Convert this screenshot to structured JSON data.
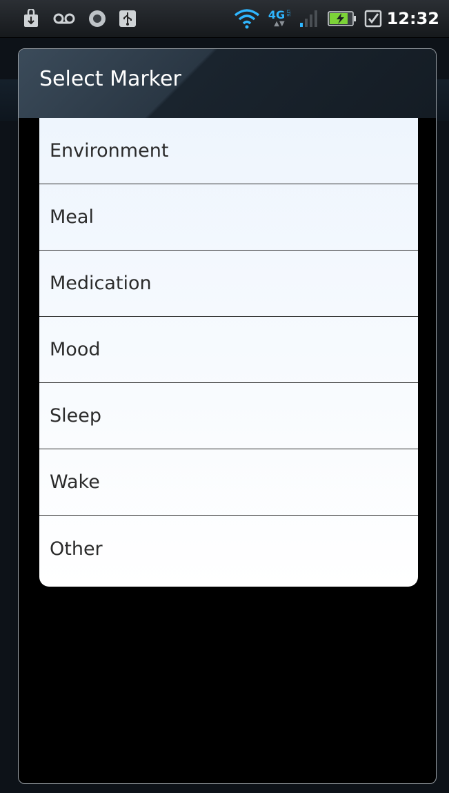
{
  "status_bar": {
    "time": "12:32",
    "network_label": "4G",
    "network_sub_label": "LTE",
    "icons": [
      "download-icon",
      "voicemail-icon",
      "app-icon",
      "usb-icon",
      "wifi-icon",
      "network-4g-lte-icon",
      "signal-icon",
      "battery-charging-icon",
      "checkbox-icon"
    ]
  },
  "dialog": {
    "title": "Select Marker",
    "items": [
      {
        "label": "Environment"
      },
      {
        "label": "Meal"
      },
      {
        "label": "Medication"
      },
      {
        "label": "Mood"
      },
      {
        "label": "Sleep"
      },
      {
        "label": "Wake"
      },
      {
        "label": "Other"
      }
    ]
  },
  "colors": {
    "list_background": "#f3f8fe",
    "list_text": "#2b2b2b",
    "title_text": "#ffffff",
    "wifi": "#2fb6ff",
    "battery_fill": "#7cd338"
  }
}
